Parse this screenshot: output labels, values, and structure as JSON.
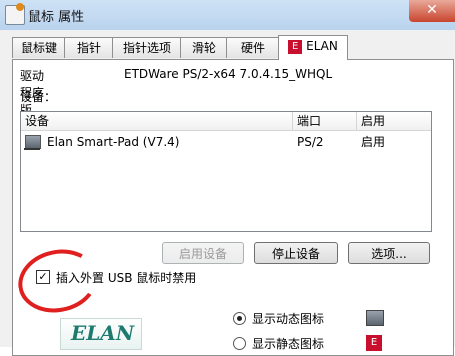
{
  "window": {
    "title": "鼠标 属性",
    "close_label": "✕"
  },
  "tabs": [
    {
      "label": "鼠标键"
    },
    {
      "label": "指针"
    },
    {
      "label": "指针选项"
    },
    {
      "label": "滑轮"
    },
    {
      "label": "硬件"
    },
    {
      "label": "ELAN"
    }
  ],
  "driver": {
    "label": "驱动程序版本：",
    "value": "ETDWare PS/2-x64 7.0.4.15_WHQL"
  },
  "devices": {
    "label": "设备：",
    "columns": [
      "设备",
      "端口",
      "启用"
    ],
    "rows": [
      {
        "name": "Elan Smart-Pad  (V7.4)",
        "port": "PS/2",
        "enabled": "启用"
      }
    ]
  },
  "buttons": {
    "enable": "启用设备",
    "stop": "停止设备",
    "options": "选项..."
  },
  "usb_checkbox": {
    "checked_mark": "✓",
    "label": "插入外置 USB 鼠标时禁用"
  },
  "tray_options": {
    "dynamic_label": "显示动态图标",
    "static_label": "显示静态图标"
  },
  "logo": {
    "text": "ELAN"
  },
  "colors": {
    "annotation_circle": "#e01f1f",
    "elan_red": "#c8102e",
    "elan_teal": "#1c7a6e"
  }
}
